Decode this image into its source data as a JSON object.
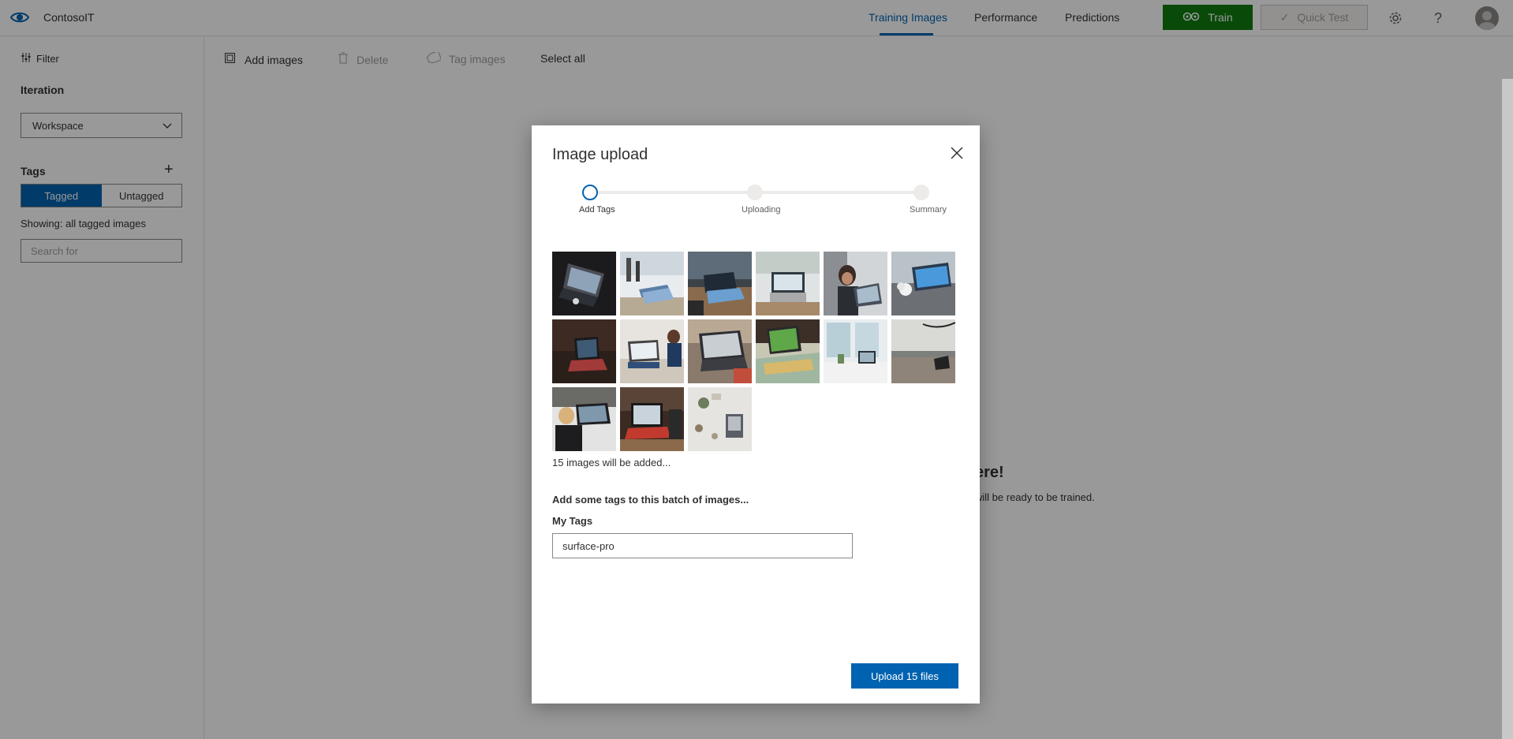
{
  "app": {
    "title": "ContosoIT",
    "nav": [
      {
        "label": "Training Images",
        "active": true
      },
      {
        "label": "Performance",
        "active": false
      },
      {
        "label": "Predictions",
        "active": false
      }
    ],
    "train_label": "Train",
    "quick_test_label": "Quick Test",
    "accent": "#0063b1",
    "train_color": "#107c10"
  },
  "sidebar": {
    "filter_label": "Filter",
    "iteration_heading": "Iteration",
    "iteration_value": "Workspace",
    "tags_heading": "Tags",
    "tagged_label": "Tagged",
    "untagged_label": "Untagged",
    "showing_text": "Showing: all tagged images",
    "search_placeholder": "Search for"
  },
  "toolbar": {
    "add_images": "Add images",
    "delete": "Delete",
    "tag_images": "Tag images",
    "select_all": "Select all"
  },
  "background": {
    "empty_heading_visible": "ere!",
    "empty_text_visible": "will be ready to be trained."
  },
  "dialog": {
    "title": "Image upload",
    "steps": [
      {
        "label": "Add Tags",
        "current": true
      },
      {
        "label": "Uploading",
        "current": false
      },
      {
        "label": "Summary",
        "current": false
      }
    ],
    "images_count_text": "15 images will be added...",
    "add_tags_prompt": "Add some tags to this batch of images...",
    "my_tags_label": "My Tags",
    "tag_value": "surface-pro",
    "upload_label": "Upload 15 files",
    "thumbnails": [
      {
        "name": "dark laptop"
      },
      {
        "name": "office laptop"
      },
      {
        "name": "cafe laptop"
      },
      {
        "name": "desk laptop"
      },
      {
        "name": "person laptop"
      },
      {
        "name": "blue screen laptop"
      },
      {
        "name": "red keyboard laptop"
      },
      {
        "name": "meeting laptop"
      },
      {
        "name": "sketch laptop"
      },
      {
        "name": "green screen tablet"
      },
      {
        "name": "window desk"
      },
      {
        "name": "beach tablet"
      },
      {
        "name": "woman laptop"
      },
      {
        "name": "red laptop desk"
      },
      {
        "name": "top view desk"
      }
    ]
  }
}
